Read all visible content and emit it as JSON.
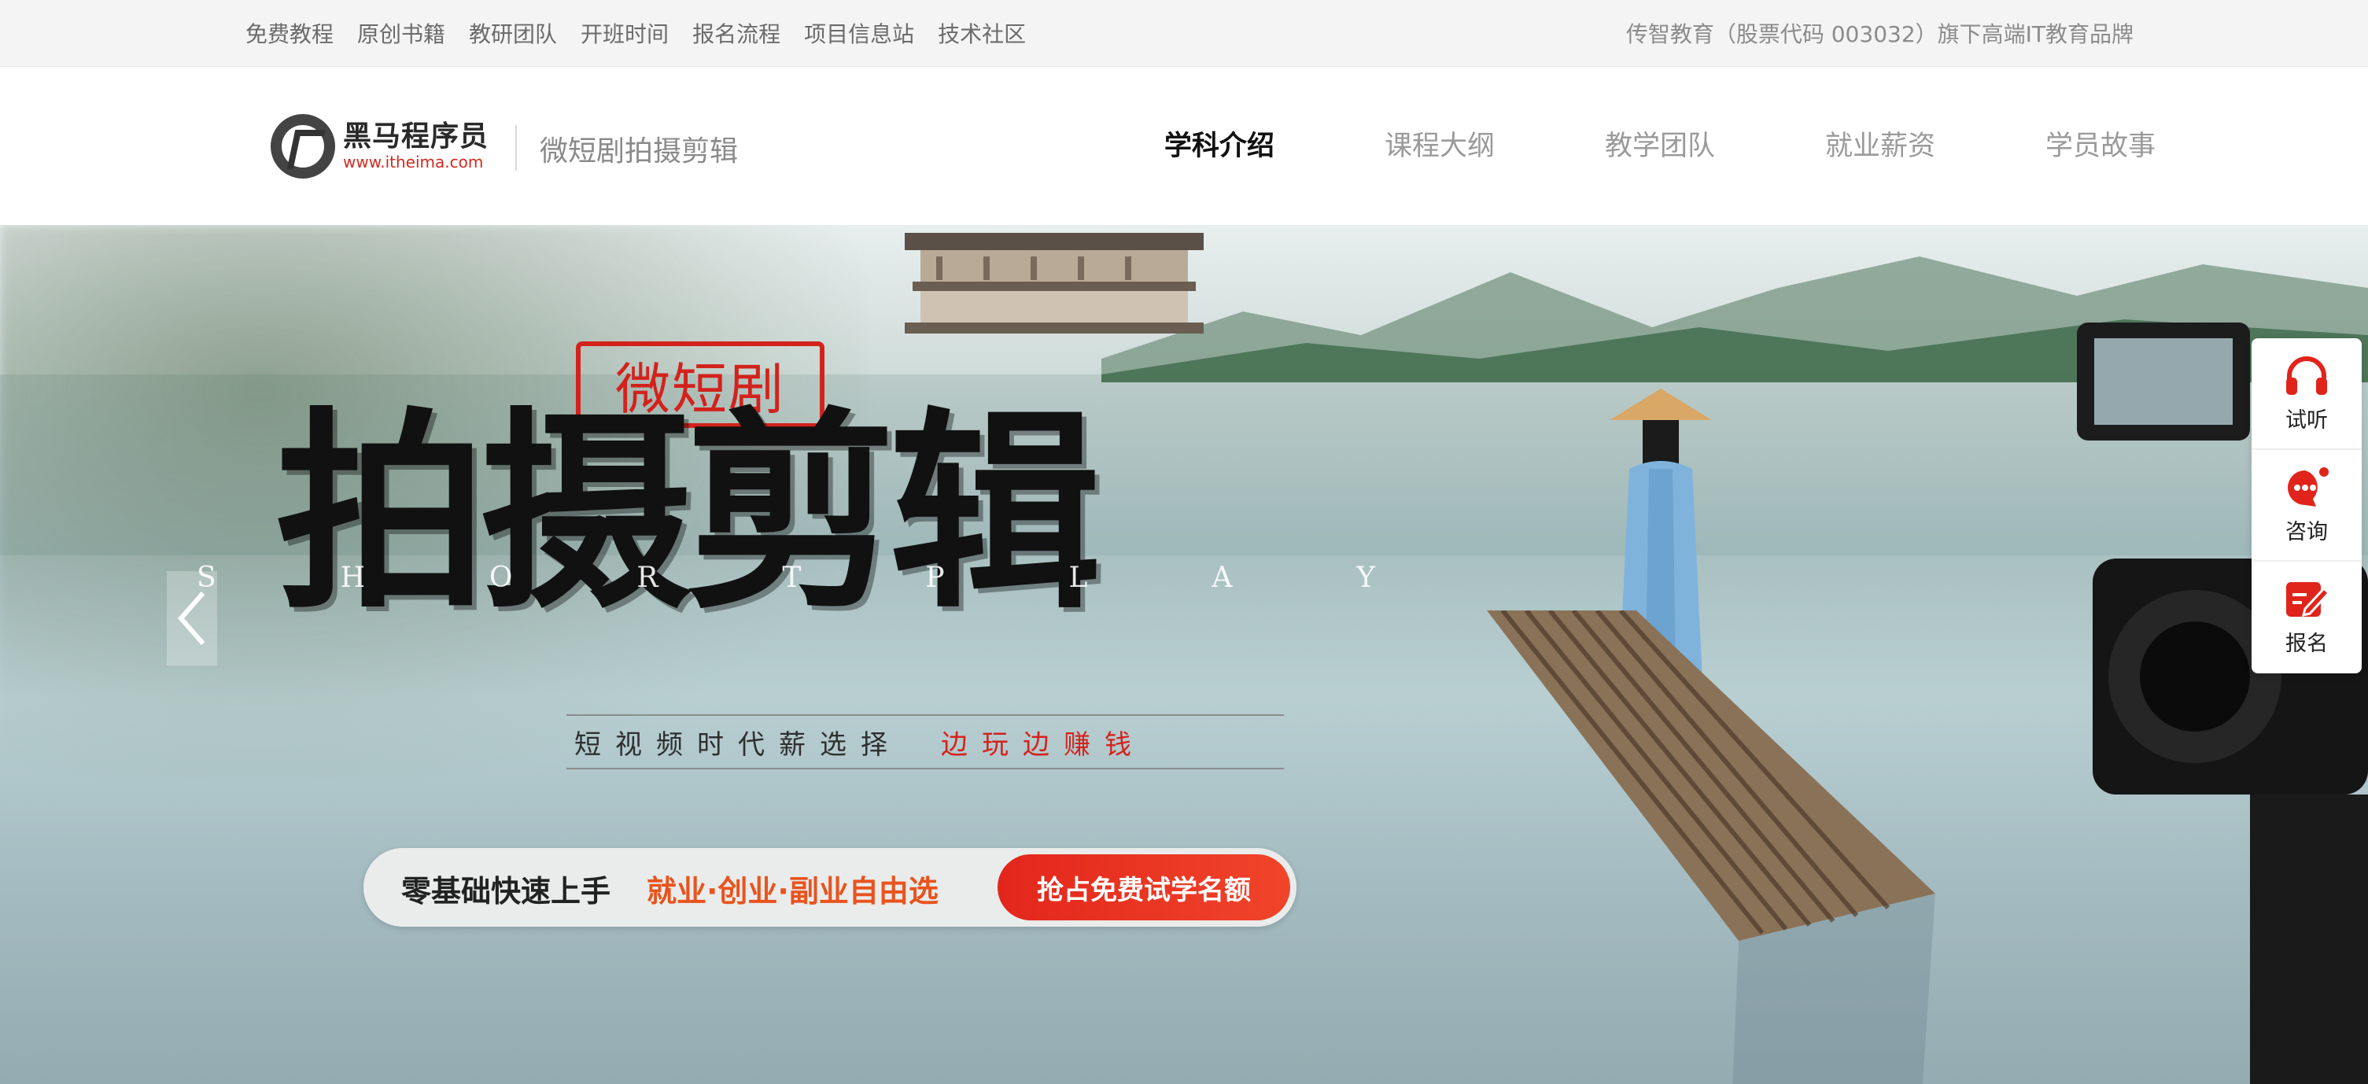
{
  "topbar": {
    "links": [
      "免费教程",
      "原创书籍",
      "教研团队",
      "开班时间",
      "报名流程",
      "项目信息站",
      "技术社区"
    ],
    "right_text": "传智教育（股票代码 003032）旗下高端IT教育品牌"
  },
  "header": {
    "logo_cn": "黑马程序员",
    "logo_en": "www.itheima.com",
    "subtitle": "微短剧拍摄剪辑",
    "nav": [
      "学科介绍",
      "课程大纲",
      "教学团队",
      "就业薪资",
      "学员故事"
    ]
  },
  "banner": {
    "stamp": "微短剧",
    "calligraphy": "拍摄剪辑",
    "shortplay_letters": [
      "S",
      "H",
      "O",
      "R",
      "T",
      "P",
      "L",
      "A",
      "Y"
    ],
    "tagline_dark": "短视频时代薪选择",
    "tagline_red": "边玩边赚钱",
    "pill_text1": "零基础快速上手",
    "pill_text2": "就业·创业·副业自由选",
    "cta": "抢占免费试学名额"
  },
  "float": {
    "items": [
      {
        "label": "试听",
        "icon": "headphones-icon"
      },
      {
        "label": "咨询",
        "icon": "chat-icon"
      },
      {
        "label": "报名",
        "icon": "signup-edit-icon"
      }
    ]
  },
  "colors": {
    "accent_red": "#d3221c",
    "cta_red": "#e3261c",
    "pill_orange": "#e8541e"
  }
}
